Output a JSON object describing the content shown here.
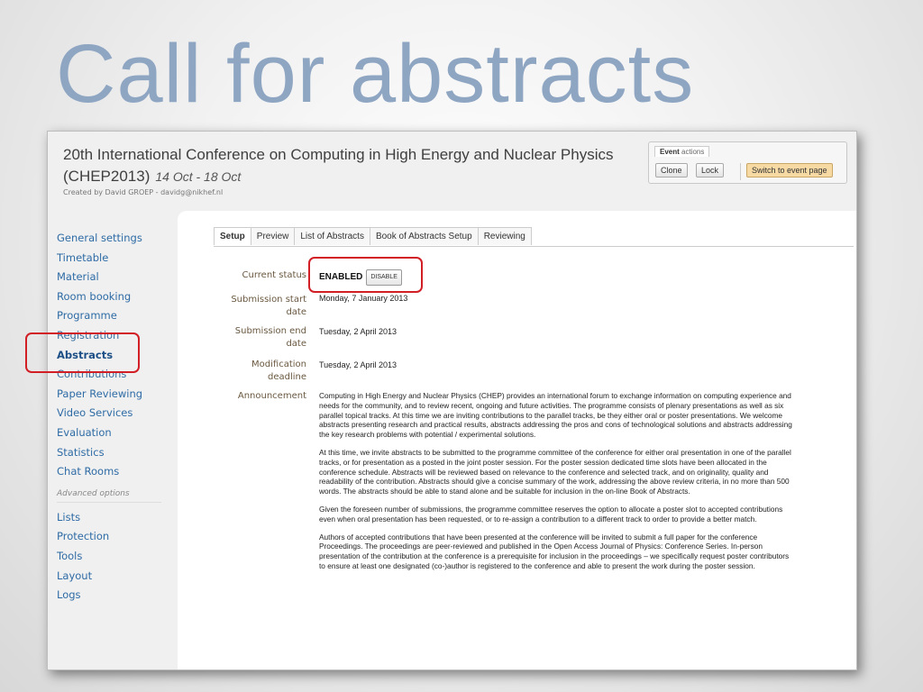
{
  "slide_title": "Call for abstracts",
  "header": {
    "conference_title": "20th International Conference on Computing in High Energy and Nuclear Physics (CHEP2013)",
    "dates": "14 Oct - 18 Oct",
    "created_by": "Created by David GROEP - davidg@nikhef.nl"
  },
  "event_actions": {
    "tab_bold": "Event",
    "tab_rest": " actions",
    "clone_label": "Clone",
    "lock_label": "Lock",
    "switch_label": "Switch to event page"
  },
  "sidebar": {
    "items": [
      {
        "label": "General settings"
      },
      {
        "label": "Timetable"
      },
      {
        "label": "Material"
      },
      {
        "label": "Room booking"
      },
      {
        "label": "Programme"
      },
      {
        "label": "Registration"
      },
      {
        "label": "Abstracts"
      },
      {
        "label": "Contributions"
      },
      {
        "label": "Paper Reviewing"
      },
      {
        "label": "Video Services"
      },
      {
        "label": "Evaluation"
      },
      {
        "label": "Statistics"
      },
      {
        "label": "Chat Rooms"
      }
    ],
    "advanced_label": "Advanced options",
    "advanced_items": [
      {
        "label": "Lists"
      },
      {
        "label": "Protection"
      },
      {
        "label": "Tools"
      },
      {
        "label": "Layout"
      },
      {
        "label": "Logs"
      }
    ]
  },
  "tabs": [
    {
      "label": "Setup"
    },
    {
      "label": "Preview"
    },
    {
      "label": "List of Abstracts"
    },
    {
      "label": "Book of Abstracts Setup"
    },
    {
      "label": "Reviewing"
    }
  ],
  "form": {
    "current_status_label": "Current status",
    "current_status_value": "ENABLED",
    "disable_label": "DISABLE",
    "submission_start_label": "Submission start date",
    "submission_start_value": "Monday, 7 January 2013",
    "submission_end_label": "Submission end date",
    "submission_end_value": "Tuesday, 2 April 2013",
    "modification_deadline_label": "Modification deadline",
    "modification_deadline_value": "Tuesday, 2 April 2013",
    "announcement_label": "Announcement",
    "announcement_paragraphs": [
      "Computing in High Energy and Nuclear Physics (CHEP) provides an international forum to exchange information on computing experience and needs for the community, and to review recent, ongoing and future activities. The programme consists of plenary presentations as well as six parallel topical tracks. At this time we are inviting contributions to the parallel tracks, be they either oral or poster presentations. We welcome abstracts presenting research and practical results, abstracts addressing the pros and cons of technological solutions and abstracts addressing the key research problems with potential / experimental solutions.",
      "At this time, we invite abstracts to be submitted to the programme committee of the conference for either oral presentation in one of the parallel tracks, or for presentation as a posted in the joint poster session. For the poster session dedicated time slots have been allocated in the conference schedule. Abstracts will be reviewed based on relevance to the conference and selected track, and on originality, quality and readability of the contribution. Abstracts should give a concise summary of the work, addressing the above review criteria, in no more than 500 words. The abstracts should be able to stand alone and be suitable for inclusion in the on-line Book of Abstracts.",
      "Given the foreseen number of submissions, the programme committee reserves the option to allocate a poster slot to accepted contributions even when oral presentation has been requested, or to re-assign a contribution to a different track to order to provide a better match.",
      "Authors of accepted contributions that have been presented at the conference will be invited to submit a full paper for the conference Proceedings. The proceedings are peer-reviewed and published in the Open Access Journal of Physics: Conference Series. In-person presentation of the contribution at the conference is a prerequisite for inclusion in the proceedings – we specifically request poster contributors to ensure at least one designated (co-)author is registered to the conference and able to present the work during the poster session."
    ]
  },
  "colors": {
    "title": "#8fa6c3",
    "link": "#2e6ba5",
    "highlight": "#d11f25",
    "switch_button": "#f7d9a3"
  }
}
